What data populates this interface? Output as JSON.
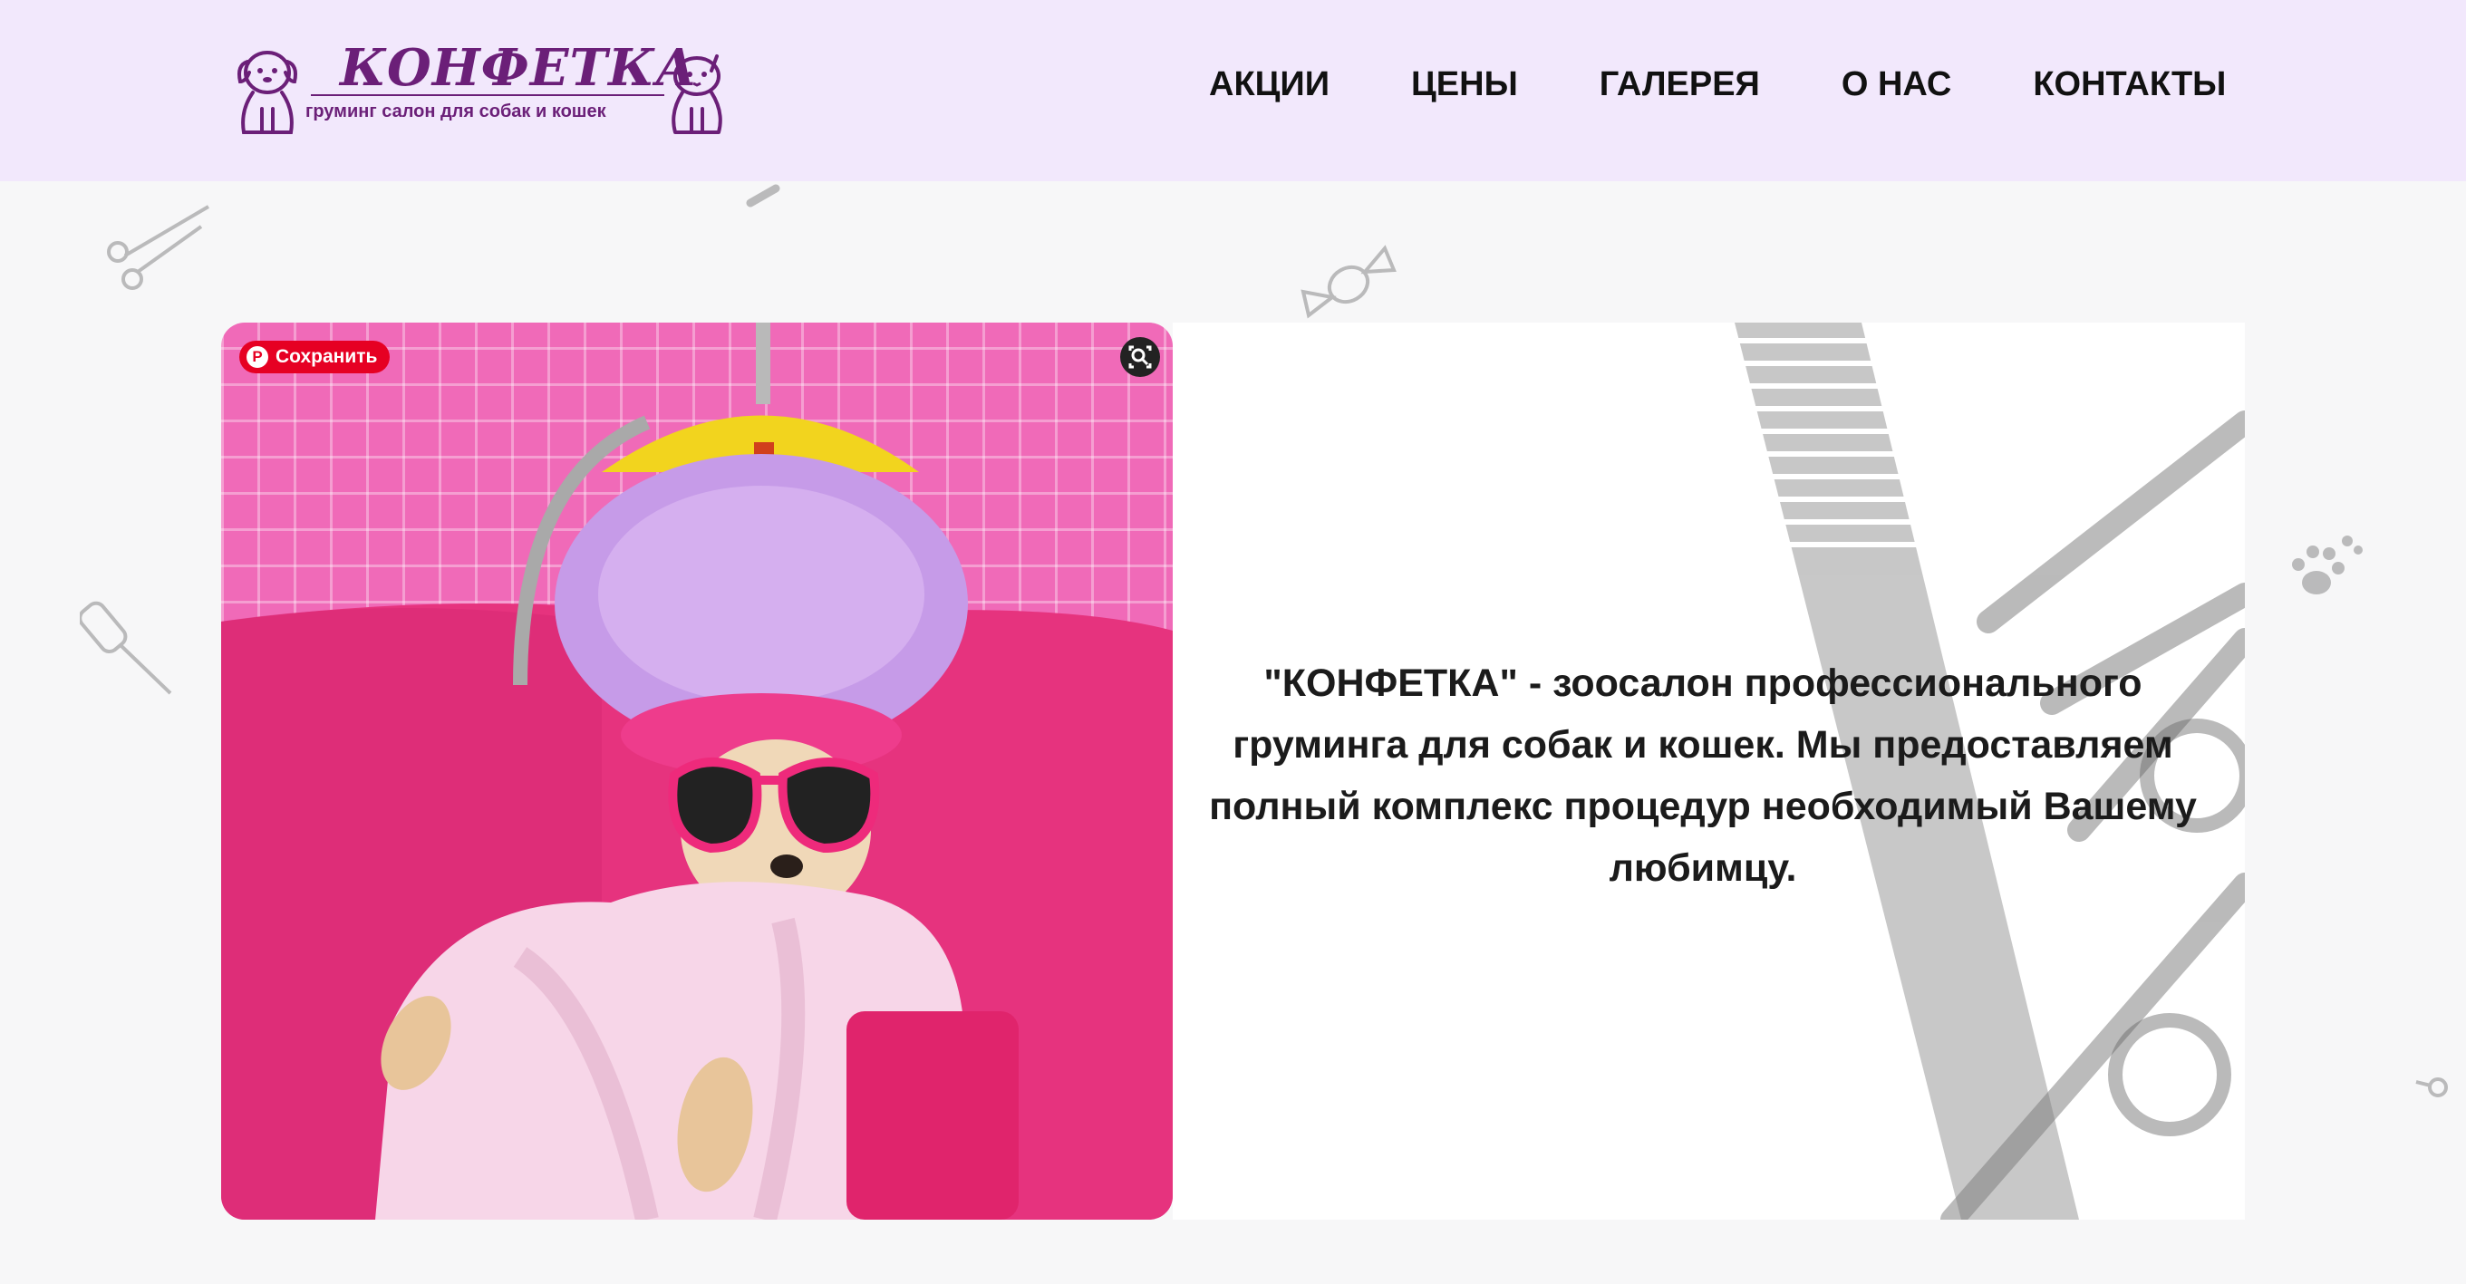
{
  "logo": {
    "title": "КОНФЕТКА",
    "subtitle": "груминг салон для собак и кошек"
  },
  "nav": {
    "items": [
      {
        "label": "АКЦИИ"
      },
      {
        "label": "ЦЕНЫ"
      },
      {
        "label": "ГАЛЕРЕЯ"
      },
      {
        "label": "О НАС"
      },
      {
        "label": "КОНТАКТЫ"
      }
    ]
  },
  "hero": {
    "description": "\"КОНФЕТКА\" - зоосалон профессионального груминга для собак и кошек. Мы предоставляем полный комплекс процедур необходимый Вашему любимцу.",
    "save_button_label": "Сохранить",
    "save_icon": "pinterest-icon",
    "lens_icon": "visual-search-icon"
  },
  "colors": {
    "header_bg": "#f2e8fc",
    "brand": "#6b1f78",
    "page_bg": "#f7f7f8",
    "pinterest_red": "#e60023"
  }
}
